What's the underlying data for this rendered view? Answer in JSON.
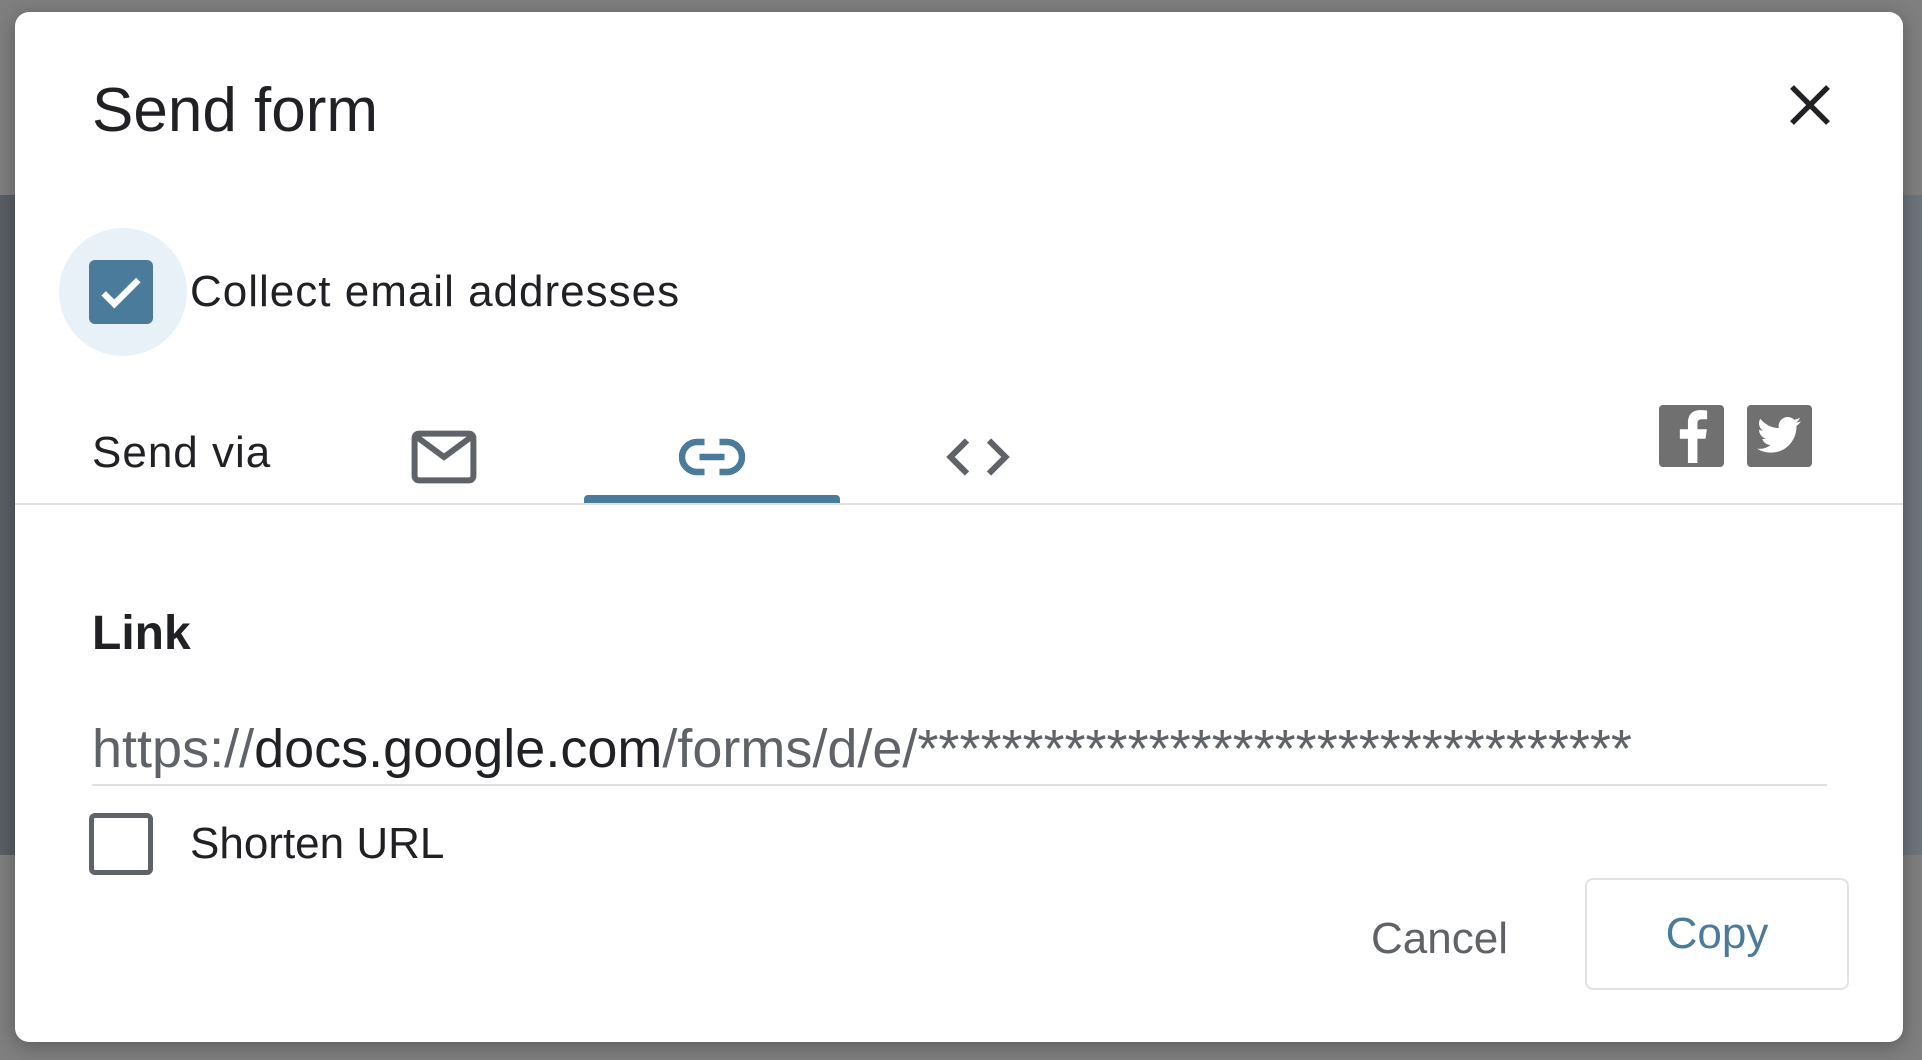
{
  "dialog": {
    "title": "Send form",
    "close_icon": "close-icon",
    "collect_email": {
      "label": "Collect email addresses",
      "checked": true
    },
    "send_via": {
      "label": "Send via",
      "tabs": [
        {
          "icon": "mail-icon",
          "selected": false
        },
        {
          "icon": "link-icon",
          "selected": true
        },
        {
          "icon": "embed-code-icon",
          "selected": false
        }
      ],
      "social": [
        {
          "icon": "facebook-icon"
        },
        {
          "icon": "twitter-icon"
        }
      ]
    },
    "link": {
      "heading": "Link",
      "url_scheme": "https://",
      "url_host": "docs.google.com",
      "url_path": "/forms/d/e/**********************************",
      "shorten": {
        "label": "Shorten URL",
        "checked": false
      }
    },
    "buttons": {
      "cancel": "Cancel",
      "copy": "Copy"
    }
  },
  "colors": {
    "accent": "#4a7b9b",
    "overlay": "#7f7f7f",
    "icon_grey": "#707070"
  }
}
